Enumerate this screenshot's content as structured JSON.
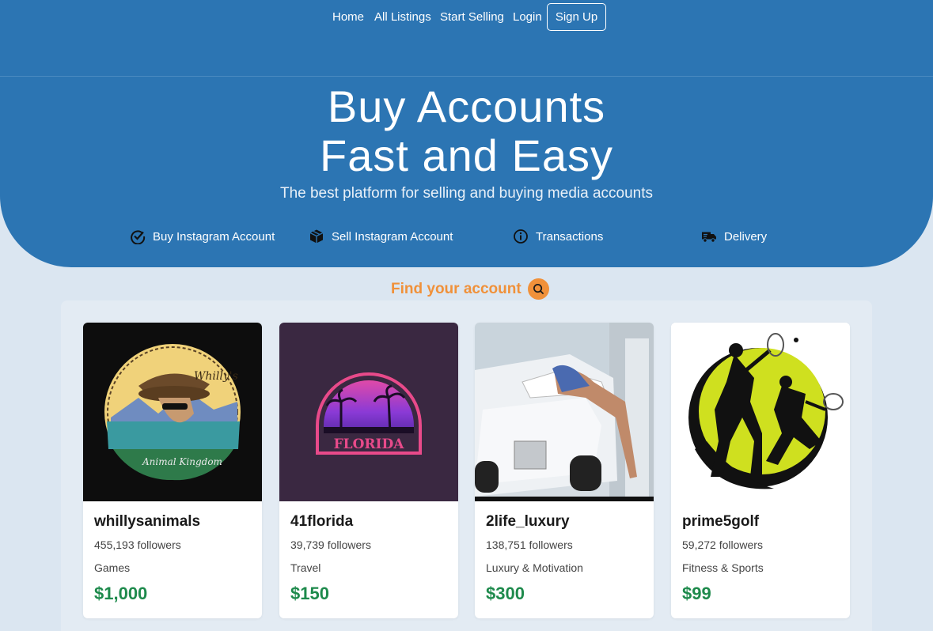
{
  "nav": {
    "home": "Home",
    "all_listings": "All Listings",
    "start_selling": "Start Selling",
    "login": "Login",
    "sign_up": "Sign Up"
  },
  "hero": {
    "title_line1": "Buy Accounts",
    "title_line2": "Fast and Easy",
    "subtitle": "The best platform for selling and buying media accounts"
  },
  "features": [
    {
      "label": "Buy Instagram Account",
      "icon": "check-circle-icon"
    },
    {
      "label": "Sell Instagram Account",
      "icon": "box-icon"
    },
    {
      "label": "Transactions",
      "icon": "info-circle-icon"
    },
    {
      "label": "Delivery",
      "icon": "truck-icon"
    }
  ],
  "search": {
    "label": "Find your account",
    "icon": "search-icon"
  },
  "listings": [
    {
      "name": "whillysanimals",
      "followers": "455,193 followers",
      "category": "Games",
      "price": "$1,000",
      "image_text_1": "Whilly's",
      "image_text_2": "Animal Kingdom"
    },
    {
      "name": "41florida",
      "followers": "39,739 followers",
      "category": "Travel",
      "price": "$150",
      "image_text_1": "FLORIDA"
    },
    {
      "name": "2life_luxury",
      "followers": "138,751 followers",
      "category": "Luxury & Motivation",
      "price": "$300"
    },
    {
      "name": "prime5golf",
      "followers": "59,272 followers",
      "category": "Fitness & Sports",
      "price": "$99"
    }
  ],
  "colors": {
    "hero": "#2c75b3",
    "background": "#dbe6f1",
    "accent_orange": "#f0913a",
    "price_green": "#1e8a4c"
  }
}
